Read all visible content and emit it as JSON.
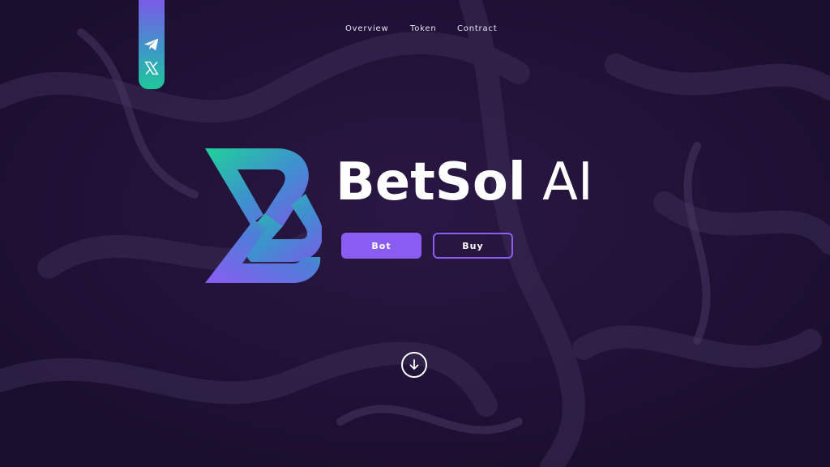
{
  "nav": {
    "items": [
      {
        "label": "Overview"
      },
      {
        "label": "Token"
      },
      {
        "label": "Contract"
      }
    ]
  },
  "social": {
    "icons": [
      "telegram-icon",
      "x-icon"
    ]
  },
  "hero": {
    "brand_bold": "BetSol",
    "brand_light": " AI",
    "buttons": {
      "bot_label": "Bot",
      "buy_label": "Buy"
    }
  },
  "scroll": {
    "icon": "arrow-down-icon"
  },
  "colors": {
    "background": "#1f1236",
    "accent": "#8a5cf2",
    "gradient_green": "#1fc79a",
    "gradient_purple": "#7a5be8"
  }
}
